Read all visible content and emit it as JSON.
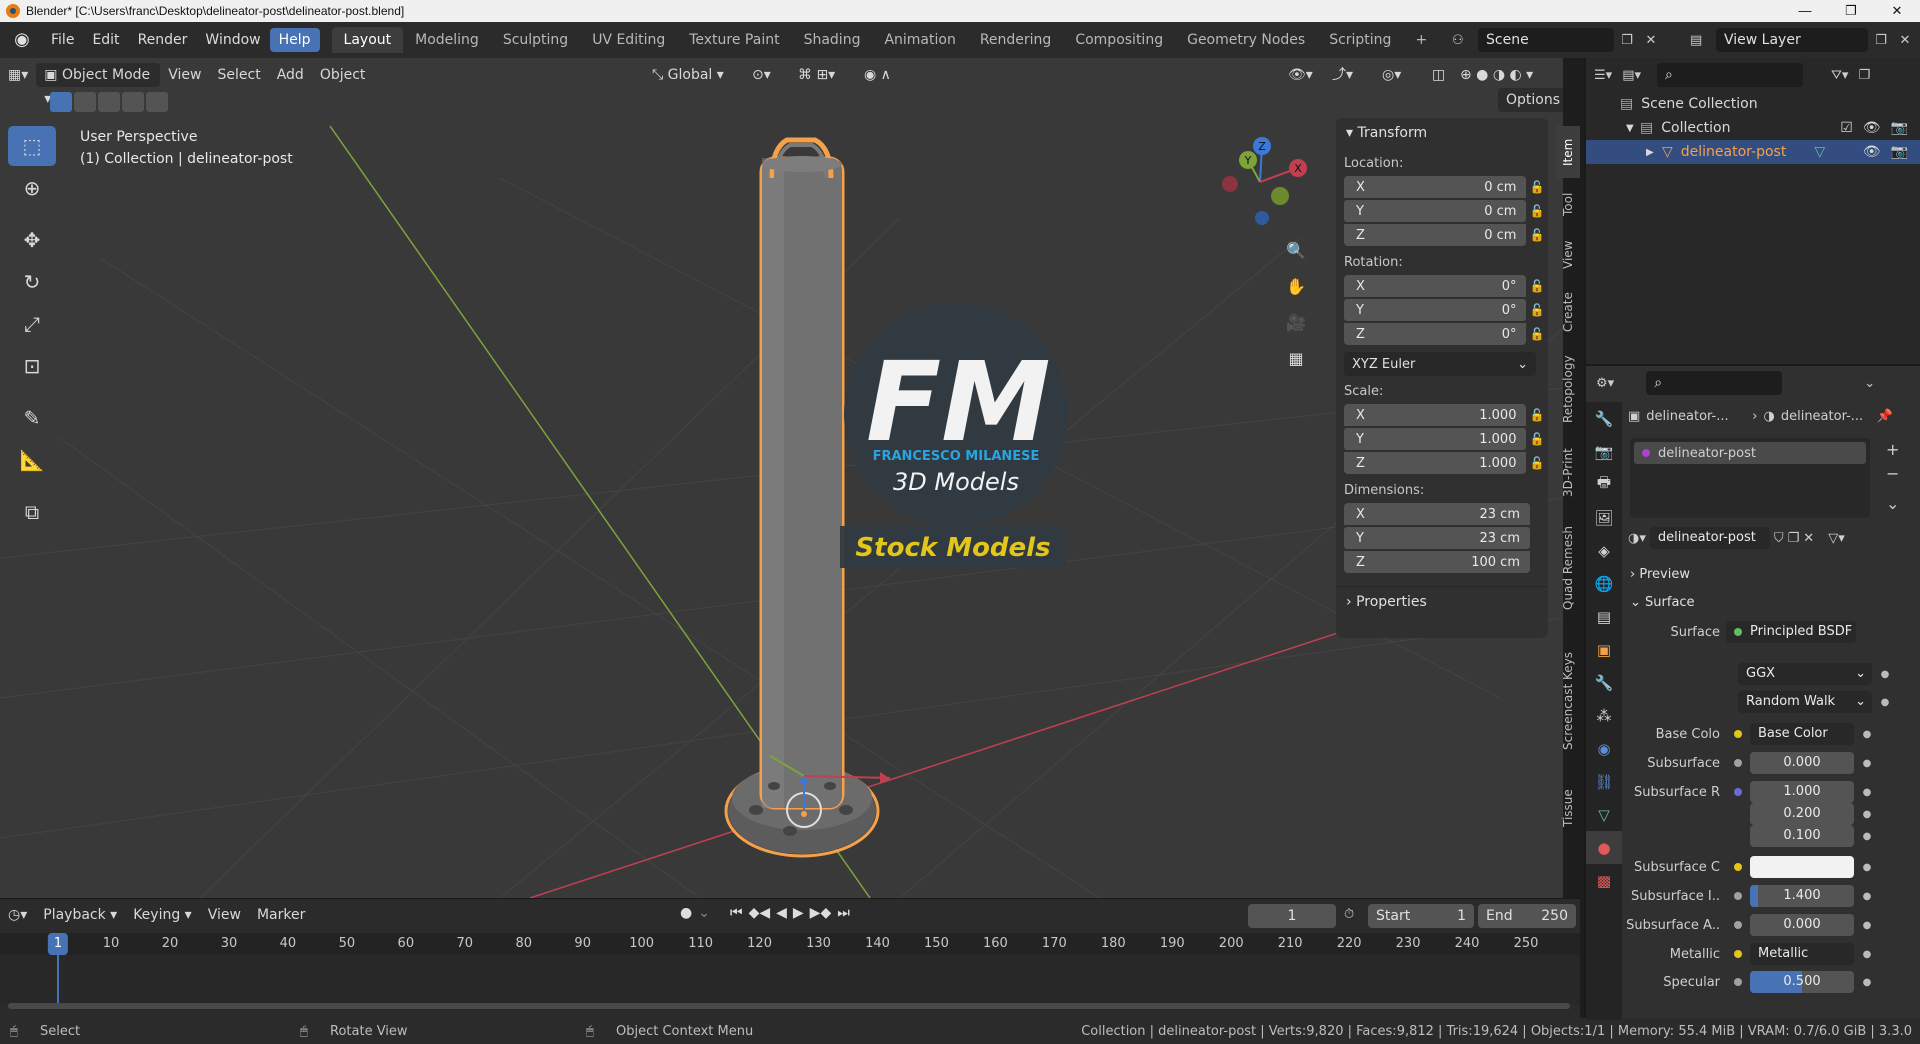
{
  "titlebar": {
    "text": "Blender* [C:\\Users\\franc\\Desktop\\delineator-post\\delineator-post.blend]",
    "minimize": "—",
    "maximize": "❐",
    "close": "✕"
  },
  "menu": [
    "File",
    "Edit",
    "Render",
    "Window",
    "Help"
  ],
  "workspaces": [
    "Layout",
    "Modeling",
    "Sculpting",
    "UV Editing",
    "Texture Paint",
    "Shading",
    "Animation",
    "Rendering",
    "Compositing",
    "Geometry Nodes",
    "Scripting"
  ],
  "scene": {
    "name": "Scene",
    "view_layer": "View Layer"
  },
  "viewport": {
    "mode": "Object Mode",
    "menus": [
      "View",
      "Select",
      "Add",
      "Object"
    ],
    "orientation": "Global",
    "options": "Options",
    "perspective": "User Perspective",
    "collection_info": "(1) Collection | delineator-post"
  },
  "watermark": {
    "logo": "FM",
    "author": "FRANCESCO MILANESE",
    "subtitle": "3D Models",
    "banner": "Stock Models"
  },
  "gizmo": {
    "x": "X",
    "y": "Y",
    "z": "Z"
  },
  "transform": {
    "title": "Transform",
    "location_label": "Location:",
    "location": [
      {
        "axis": "X",
        "value": "0 cm"
      },
      {
        "axis": "Y",
        "value": "0 cm"
      },
      {
        "axis": "Z",
        "value": "0 cm"
      }
    ],
    "rotation_label": "Rotation:",
    "rotation": [
      {
        "axis": "X",
        "value": "0°"
      },
      {
        "axis": "Y",
        "value": "0°"
      },
      {
        "axis": "Z",
        "value": "0°"
      }
    ],
    "rotation_mode": "XYZ Euler",
    "scale_label": "Scale:",
    "scale": [
      {
        "axis": "X",
        "value": "1.000"
      },
      {
        "axis": "Y",
        "value": "1.000"
      },
      {
        "axis": "Z",
        "value": "1.000"
      }
    ],
    "dimensions_label": "Dimensions:",
    "dimensions": [
      {
        "axis": "X",
        "value": "23 cm"
      },
      {
        "axis": "Y",
        "value": "23 cm"
      },
      {
        "axis": "Z",
        "value": "100 cm"
      }
    ],
    "properties": "Properties"
  },
  "side_tabs": [
    "Item",
    "Tool",
    "View",
    "Create",
    "Retopology",
    "3D-Print",
    "Quad Remesh",
    "Screencast Keys",
    "Tissue"
  ],
  "timeline": {
    "menus": [
      "Playback",
      "Keying",
      "View",
      "Marker"
    ],
    "current_frame": "1",
    "start_label": "Start",
    "start": "1",
    "end_label": "End",
    "end": "250",
    "ticks": [
      "1",
      "10",
      "20",
      "30",
      "40",
      "50",
      "60",
      "70",
      "80",
      "90",
      "100",
      "110",
      "120",
      "130",
      "140",
      "150",
      "160",
      "170",
      "180",
      "190",
      "200",
      "210",
      "220",
      "230",
      "240",
      "250"
    ]
  },
  "statusbar": {
    "select": "Select",
    "rotate": "Rotate View",
    "context": "Object Context Menu",
    "stats": "Collection | delineator-post | Verts:9,820 | Faces:9,812 | Tris:19,624 | Objects:1/1 | Memory: 55.4 MiB | VRAM: 0.7/6.0 GiB | 3.3.0"
  },
  "outliner": {
    "root": "Scene Collection",
    "collection": "Collection",
    "object": "delineator-post"
  },
  "properties": {
    "breadcrumb_object": "delineator-...",
    "breadcrumb_material": "delineator-...",
    "slot": "delineator-post",
    "material": "delineator-post",
    "preview": "Preview",
    "surface_section": "Surface",
    "surface_label": "Surface",
    "surface_value": "Principled BSDF",
    "distribution": "GGX",
    "subsurface_method": "Random Walk",
    "rows": [
      {
        "label": "Base Colo",
        "value": "Base Color",
        "kind": "link"
      },
      {
        "label": "Subsurface",
        "value": "0.000",
        "kind": "num"
      },
      {
        "label": "Subsurface R",
        "value": "1.000",
        "kind": "num"
      },
      {
        "label": "",
        "value": "0.200",
        "kind": "num"
      },
      {
        "label": "",
        "value": "0.100",
        "kind": "num"
      },
      {
        "label": "Subsurface C",
        "value": "",
        "kind": "color"
      },
      {
        "label": "Subsurface I..",
        "value": "1.400",
        "kind": "num"
      },
      {
        "label": "Subsurface A..",
        "value": "0.000",
        "kind": "num"
      },
      {
        "label": "Metallic",
        "value": "Metallic",
        "kind": "link"
      },
      {
        "label": "Specular",
        "value": "0.500",
        "kind": "num"
      }
    ]
  },
  "colors": {
    "accent": "#4772b3",
    "selection_orange": "#f5a14a",
    "banner_yellow": "#e3c61a",
    "logo_blue": "#2ba3e0"
  }
}
